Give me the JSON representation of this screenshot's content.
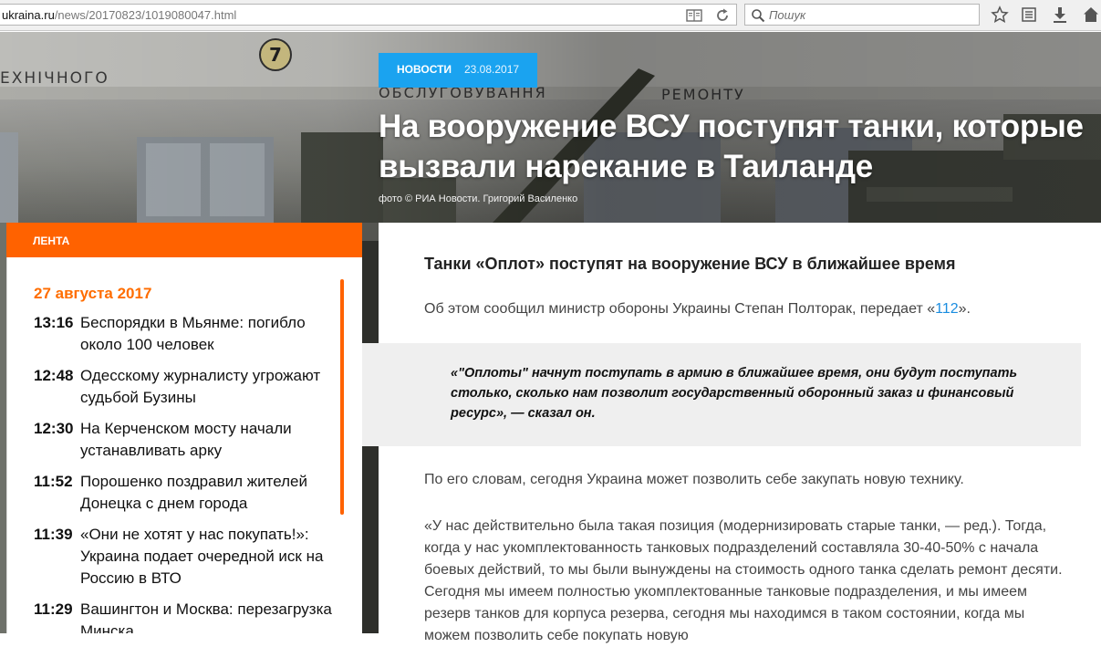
{
  "browser": {
    "url_host": "ukraina.ru",
    "url_path": "/news/20170823/1019080047.html",
    "search_placeholder": "Пошук"
  },
  "hero": {
    "category": "НОВОСТИ",
    "date": "23.08.2017",
    "title": "На вооружение ВСУ поступят танки, которые вызвали нарекание в Таиланде",
    "credit": "фото © РИА Новости. Григорий Василенко"
  },
  "feed": {
    "title": "ЛЕНТА",
    "date": "27 августа 2017",
    "items": [
      {
        "time": "13:16",
        "text": "Беспорядки в Мьянме: погибло около 100 человек"
      },
      {
        "time": "12:48",
        "text": "Одесскому журналисту угрожают судьбой Бузины"
      },
      {
        "time": "12:30",
        "text": "На Керченском мосту начали устанавливать арку"
      },
      {
        "time": "11:52",
        "text": "Порошенко поздравил жителей Донецка с днем города"
      },
      {
        "time": "11:39",
        "text": "«Они не хотят у нас покупать!»: Украина подает очередной иск на Россию в ВТО"
      },
      {
        "time": "11:29",
        "text": "Вашингтон и Москва: перезагрузка Минска"
      }
    ]
  },
  "article": {
    "subhead": "Танки «Оплот» поступят на вооружение ВСУ в ближайшее время",
    "p1_before": "Об этом сообщил министр обороны Украины Степан Полторак, передает «",
    "p1_link": "112",
    "p1_after": "».",
    "quote": "«\"Оплоты\" начнут поступать в армию в ближайшее время, они будут поступать столько, сколько нам позволит государственный оборонный заказ и финансовый ресурс», — сказал он.",
    "p2": "По его словам, сегодня Украина может позволить себе закупать новую технику.",
    "p3": "«У нас действительно была такая позиция (модернизировать старые танки, — ред.). Тогда, когда у нас укомплектованность танковых подразделений составляла 30-40-50% с начала боевых действий, то мы были вынуждены на стоимость одного танка сделать ремонт десяти. Сегодня мы имеем полностью укомплектованные танковые подразделения, и мы имеем резерв танков для корпуса резерва,  сегодня мы находимся в таком состоянии, когда мы можем позволить себе покупать новую"
  }
}
